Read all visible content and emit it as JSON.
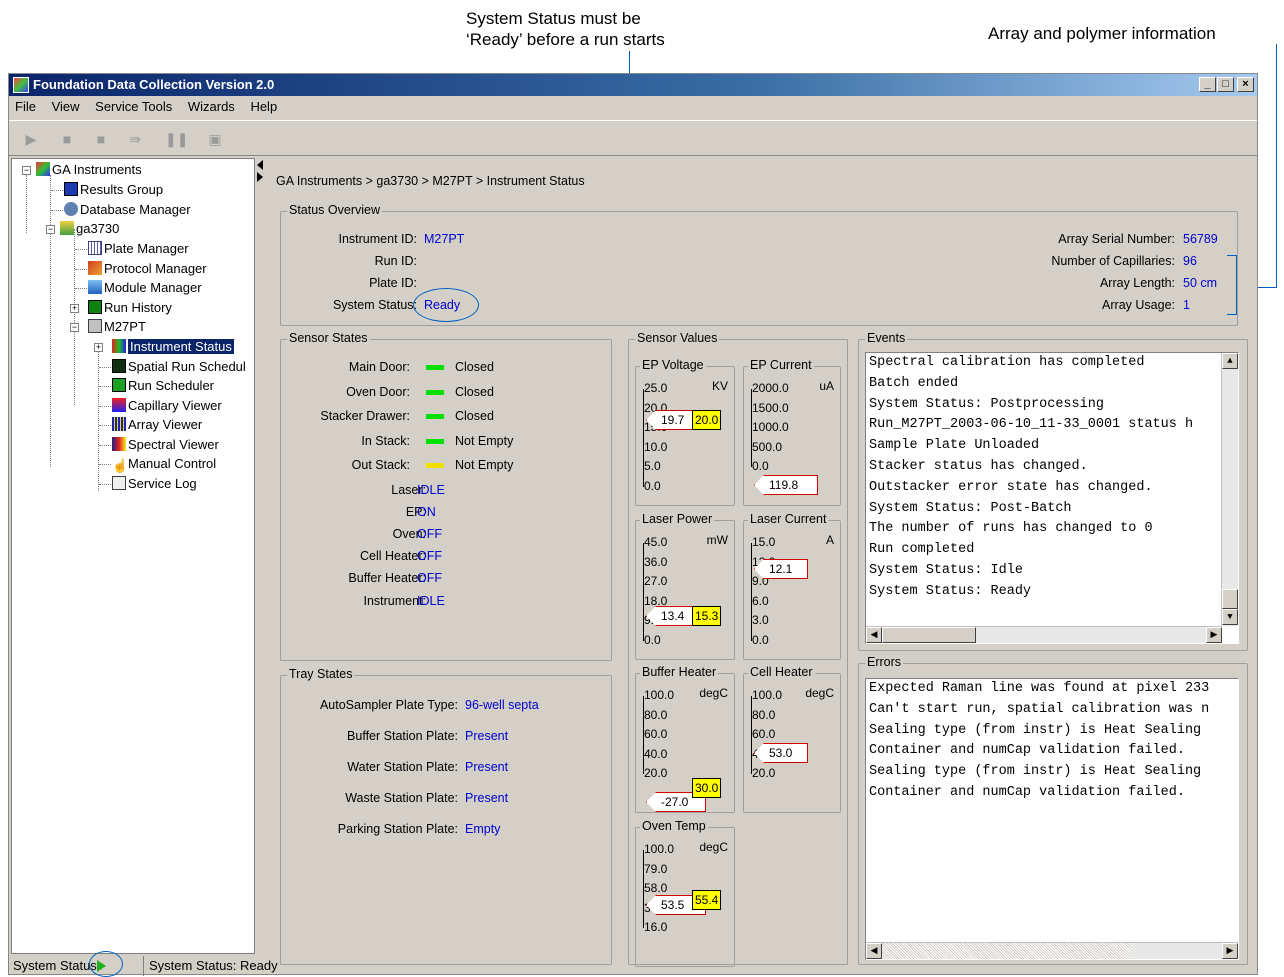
{
  "callouts": {
    "system_status_line1": "System Status must be",
    "system_status_line2": "‘Ready’ before a run starts",
    "array_info": "Array and polymer information"
  },
  "window": {
    "title": "Foundation Data Collection Version 2.0",
    "min": "_",
    "max": "□",
    "close": "×"
  },
  "menu": [
    "File",
    "View",
    "Service Tools",
    "Wizards",
    "Help"
  ],
  "tree": {
    "root": "GA Instruments",
    "results_group": "Results Group",
    "database_manager": "Database Manager",
    "instrument": "ga3730",
    "plate_manager": "Plate Manager",
    "protocol_manager": "Protocol Manager",
    "module_manager": "Module Manager",
    "run_history": "Run History",
    "m27pt": "M27PT",
    "instrument_status": "Instrument Status",
    "spatial_run": "Spatial Run Schedul",
    "run_scheduler": "Run Scheduler",
    "capillary_viewer": "Capillary Viewer",
    "array_viewer": "Array Viewer",
    "spectral_viewer": "Spectral Viewer",
    "manual_control": "Manual Control",
    "service_log": "Service Log"
  },
  "breadcrumb": "GA Instruments > ga3730 > M27PT > Instrument Status",
  "status_overview": {
    "title": "Status Overview",
    "instrument_id_label": "Instrument ID:",
    "instrument_id": "M27PT",
    "run_id_label": "Run ID:",
    "plate_id_label": "Plate ID:",
    "system_status_label": "System Status:",
    "system_status": "Ready",
    "array_serial_label": "Array Serial Number:",
    "array_serial": "56789",
    "num_caps_label": "Number of Capillaries:",
    "num_caps": "96",
    "array_length_label": "Array Length:",
    "array_length": "50 cm",
    "array_usage_label": "Array Usage:",
    "array_usage": "1"
  },
  "sensor_states": {
    "title": "Sensor States",
    "leds": [
      {
        "label": "Main Door:",
        "value": "Closed",
        "color": "#00e000"
      },
      {
        "label": "Oven Door:",
        "value": "Closed",
        "color": "#00e000"
      },
      {
        "label": "Stacker Drawer:",
        "value": "Closed",
        "color": "#00e000"
      },
      {
        "label": "In Stack:",
        "value": "Not Empty",
        "color": "#00e000"
      },
      {
        "label": "Out Stack:",
        "value": "Not Empty",
        "color": "#f0e000"
      }
    ],
    "states": [
      {
        "label": "Laser:",
        "value": "IDLE"
      },
      {
        "label": "EP:",
        "value": "ON"
      },
      {
        "label": "Oven:",
        "value": "OFF"
      },
      {
        "label": "Cell Heater:",
        "value": "OFF"
      },
      {
        "label": "Buffer Heater:",
        "value": "OFF"
      },
      {
        "label": "Instrument:",
        "value": "IDLE"
      }
    ]
  },
  "tray_states": {
    "title": "Tray States",
    "rows": [
      {
        "label": "AutoSampler Plate Type:",
        "value": "96-well septa"
      },
      {
        "label": "Buffer Station Plate:",
        "value": "Present"
      },
      {
        "label": "Water Station Plate:",
        "value": "Present"
      },
      {
        "label": "Waste Station Plate:",
        "value": "Present"
      },
      {
        "label": "Parking Station Plate:",
        "value": "Empty"
      }
    ]
  },
  "sensor_values": {
    "title": "Sensor Values",
    "ep_voltage": {
      "title": "EP Voltage",
      "unit": "KV",
      "ticks": [
        "25.0",
        "20.0",
        "15.0",
        "10.0",
        "5.0",
        "0.0"
      ],
      "reading": "19.7",
      "setpoint": "20.0"
    },
    "ep_current": {
      "title": "EP Current",
      "unit": "uA",
      "ticks": [
        "2000.0",
        "1500.0",
        "1000.0",
        "500.0",
        "0.0"
      ],
      "reading": "119.8"
    },
    "laser_power": {
      "title": "Laser Power",
      "unit": "mW",
      "ticks": [
        "45.0",
        "36.0",
        "27.0",
        "18.0",
        "9.0",
        "0.0"
      ],
      "reading": "13.4",
      "setpoint": "15.3"
    },
    "laser_current": {
      "title": "Laser Current",
      "unit": "A",
      "ticks": [
        "15.0",
        "12.0",
        "9.0",
        "6.0",
        "3.0",
        "0.0"
      ],
      "reading": "12.1"
    },
    "buffer_heater": {
      "title": "Buffer Heater",
      "unit": "degC",
      "ticks": [
        "100.0",
        "80.0",
        "60.0",
        "40.0",
        "20.0"
      ],
      "reading": "-27.0",
      "setpoint": "30.0"
    },
    "cell_heater": {
      "title": "Cell Heater",
      "unit": "degC",
      "ticks": [
        "100.0",
        "80.0",
        "60.0",
        "40.0",
        "20.0"
      ],
      "reading": "53.0"
    },
    "oven_temp": {
      "title": "Oven Temp",
      "unit": "degC",
      "ticks": [
        "100.0",
        "79.0",
        "58.0",
        "37.0",
        "16.0"
      ],
      "reading": "53.5",
      "setpoint": "55.4"
    }
  },
  "events": {
    "title": "Events",
    "lines": [
      "Spectral calibration has completed",
      "Batch ended",
      "System Status: Postprocessing",
      "Run_M27PT_2003-06-10_11-33_0001 status h",
      "Sample Plate Unloaded",
      "Stacker status has changed.",
      "Outstacker error state has changed.",
      "System Status: Post-Batch",
      "The number of runs has changed to 0",
      "Run completed",
      "System Status: Idle",
      "System Status: Ready"
    ]
  },
  "errors": {
    "title": "Errors",
    "lines": [
      "Expected Raman line was found at pixel 233",
      "Can't start run, spatial calibration was n",
      "Sealing type (from instr) is Heat Sealing",
      "Container and numCap validation failed.",
      "Sealing type (from instr) is Heat Sealing",
      "Container and numCap validation failed."
    ]
  },
  "statusbar": {
    "left": "System Status",
    "right": "System Status: Ready"
  }
}
